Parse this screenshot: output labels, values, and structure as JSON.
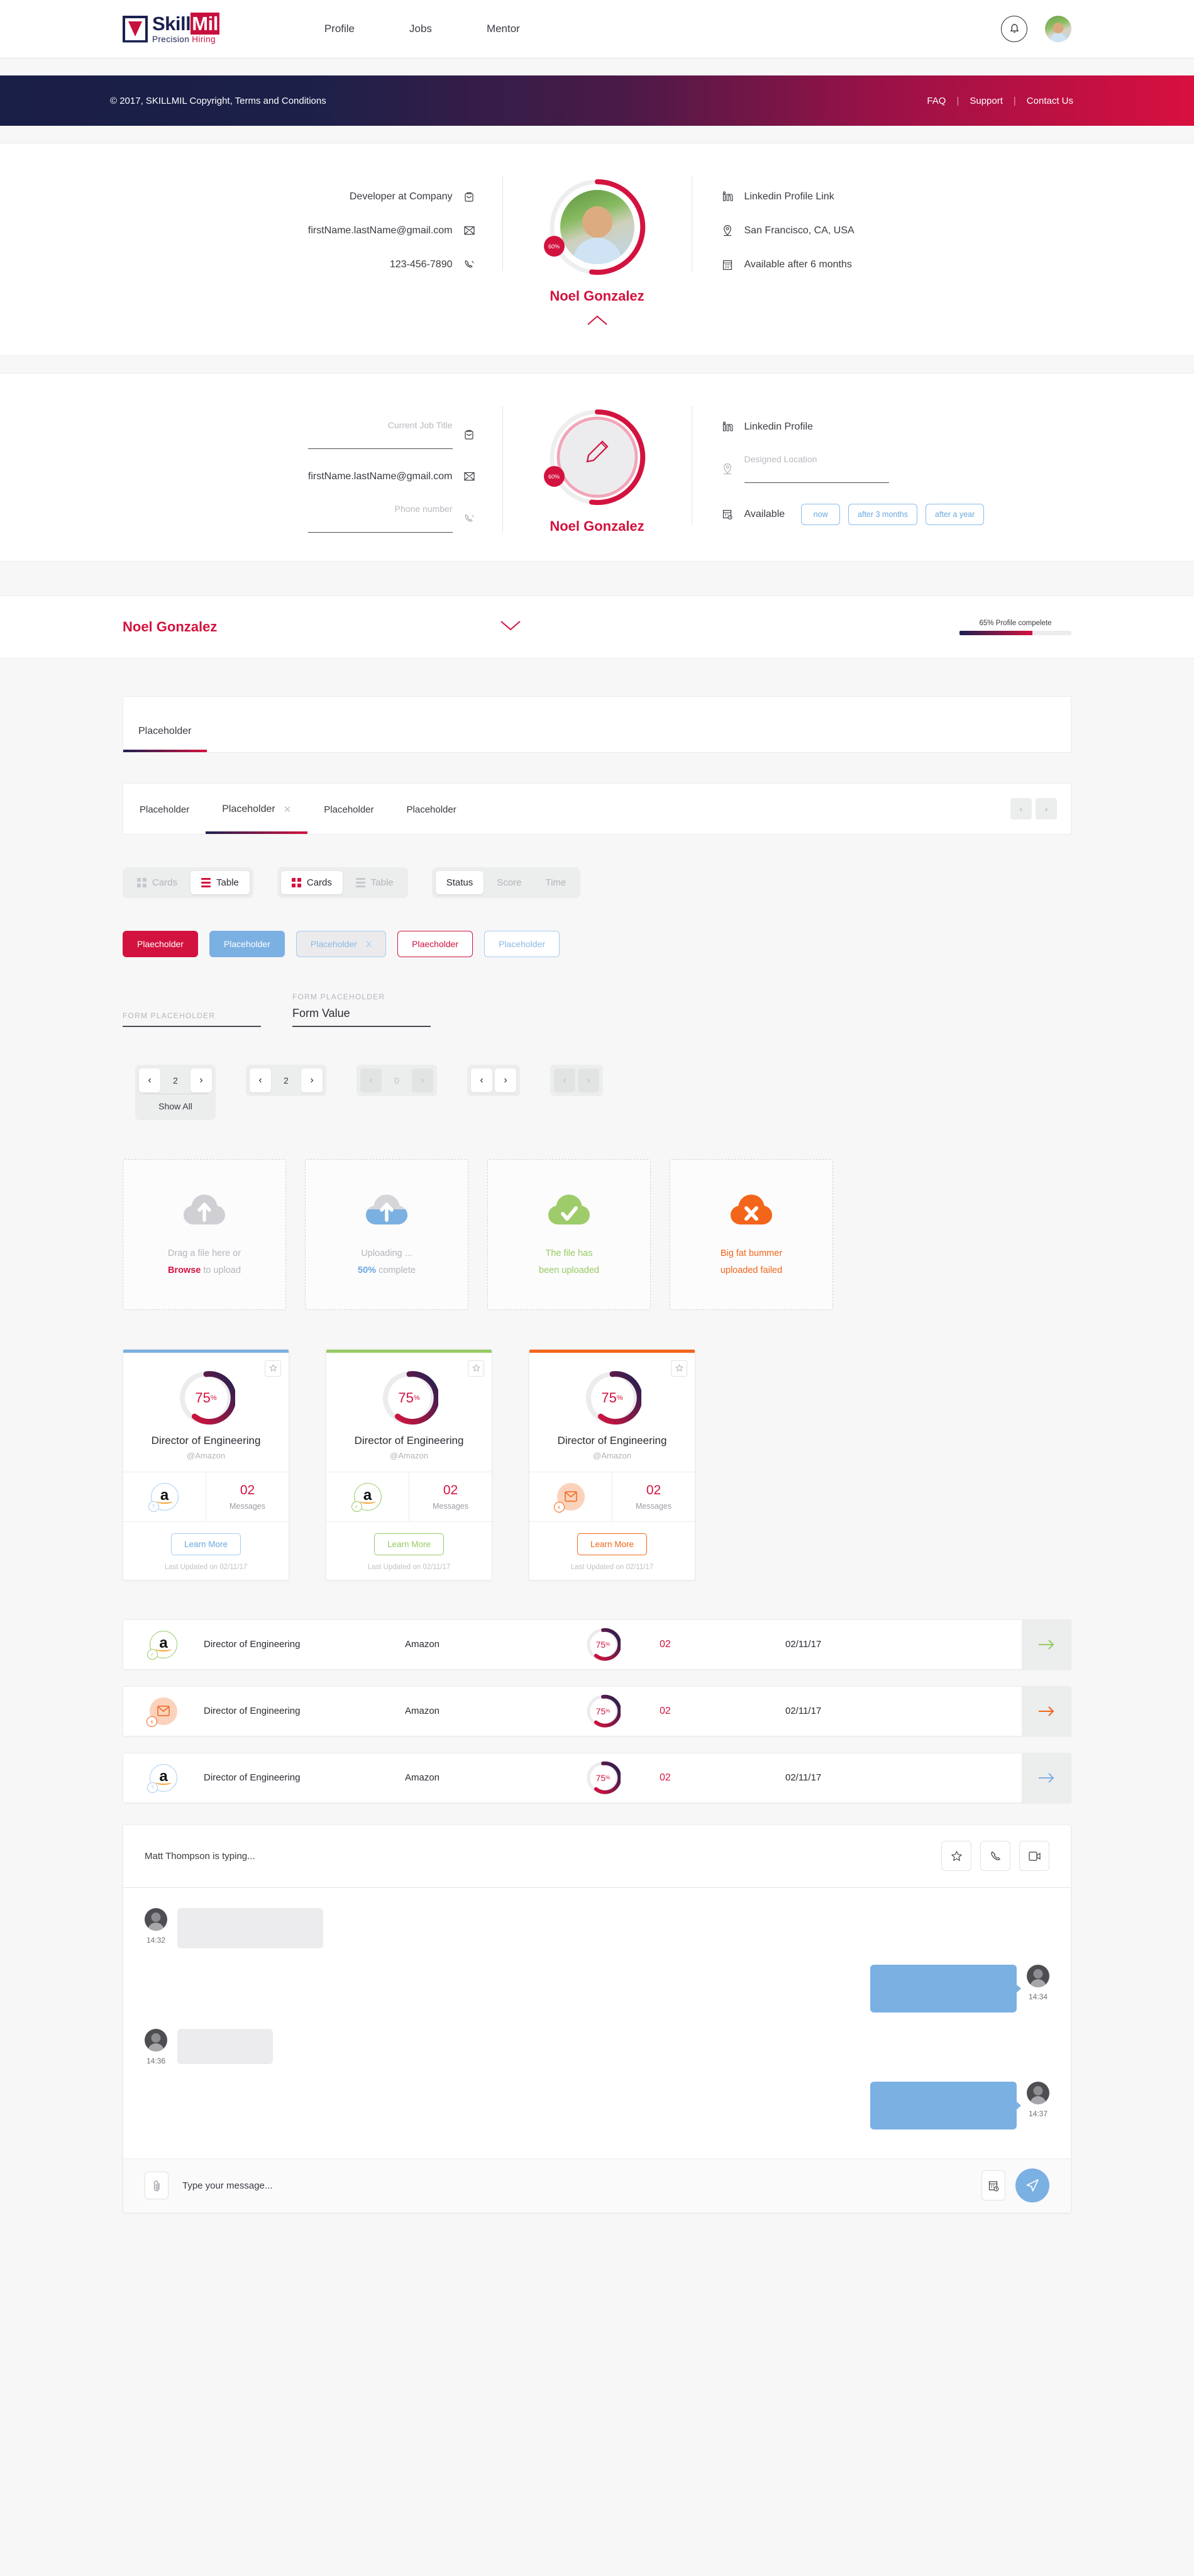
{
  "header": {
    "logo": {
      "name_part1": "Skill",
      "name_part2": "Mil",
      "tagline_1": "Precision",
      "tagline_2": "Hiring"
    },
    "nav": [
      {
        "label": "Profile"
      },
      {
        "label": "Jobs"
      },
      {
        "label": "Mentor"
      }
    ],
    "bell_icon": "bell-icon",
    "avatar_icon": "user-avatar"
  },
  "footbar": {
    "copyright": "© 2017, SKILLMIL   Copyright, Terms and Conditions",
    "links": [
      "FAQ",
      "Support",
      "Contact Us"
    ]
  },
  "profile_view": {
    "left": [
      {
        "text": "Developer at Company",
        "icon": "briefcase-icon"
      },
      {
        "text": "firstName.lastName@gmail.com",
        "icon": "envelope-icon"
      },
      {
        "text": "123-456-7890",
        "icon": "phone-icon"
      }
    ],
    "name": "Noel Gonzalez",
    "badge": "60%",
    "right": [
      {
        "text": "Linkedin Profile Link",
        "icon": "linkedin-icon"
      },
      {
        "text": "San Francisco, CA, USA",
        "icon": "location-pin-icon"
      },
      {
        "text": "Available after 6 months",
        "icon": "calendar-icon"
      }
    ]
  },
  "profile_edit": {
    "job_title_placeholder": "Current Job Title",
    "job_title_value": "",
    "email_value": "firstName.lastName@gmail.com",
    "phone_placeholder": "Phone number",
    "phone_value": "",
    "name": "Noel Gonzalez",
    "badge": "60%",
    "linkedin_label": "Linkedin Profile",
    "location_placeholder": "Designed Location",
    "location_value": "",
    "available_label": "Available",
    "available_options": [
      "now",
      "after 3 months",
      "after a year"
    ]
  },
  "namebar": {
    "name": "Noel Gonzalez",
    "progress_label": "65% Profile compelete",
    "progress_percent": 65
  },
  "tabs_single": [
    {
      "label": "Placeholder",
      "active": true
    }
  ],
  "tabs_multi": [
    {
      "label": "Placeholder",
      "active": false,
      "closable": false
    },
    {
      "label": "Placeholder",
      "active": true,
      "closable": true
    },
    {
      "label": "Placeholder",
      "active": false,
      "closable": false
    },
    {
      "label": "Placeholder",
      "active": false,
      "closable": false
    }
  ],
  "tabs_nav": {
    "prev": "‹",
    "next": "›"
  },
  "segment_groups": [
    {
      "items": [
        {
          "label": "Cards",
          "icon": "cards-grid-icon",
          "active": false
        },
        {
          "label": "Table",
          "icon": "table-rows-icon",
          "active": true
        }
      ]
    },
    {
      "items": [
        {
          "label": "Cards",
          "icon": "cards-grid-icon",
          "active": true
        },
        {
          "label": "Table",
          "icon": "table-rows-icon",
          "active": false
        }
      ]
    },
    {
      "items": [
        {
          "label": "Status",
          "icon": "",
          "active": true
        },
        {
          "label": "Score",
          "icon": "",
          "active": false
        },
        {
          "label": "Time",
          "icon": "",
          "active": false
        }
      ]
    }
  ],
  "pills": [
    {
      "label": "Plaecholder",
      "style": "solid-red"
    },
    {
      "label": "Placeholder",
      "style": "solid-blue"
    },
    {
      "label": "Placeholder",
      "style": "grey-blue",
      "close": "X"
    },
    {
      "label": "Plaecholder",
      "style": "out-red"
    },
    {
      "label": "Placeholder",
      "style": "out-blue"
    }
  ],
  "form_fields": [
    {
      "label": "FORM PLACEHOLDER",
      "value": ""
    },
    {
      "label": "FORM PLACEHOLDER",
      "value": "Form Value"
    }
  ],
  "pagers": [
    {
      "prev": "‹",
      "page": "2",
      "next": "›",
      "show_all": "Show All",
      "disabled": false,
      "arrows_only": false
    },
    {
      "prev": "‹",
      "page": "2",
      "next": "›",
      "disabled": false,
      "arrows_only": false
    },
    {
      "prev": "‹",
      "page": "0",
      "next": "›",
      "disabled": true,
      "arrows_only": false
    },
    {
      "prev": "‹",
      "next": "›",
      "disabled": false,
      "arrows_only": true
    },
    {
      "prev": "‹",
      "next": "›",
      "disabled": true,
      "arrows_only": true
    }
  ],
  "uploads": [
    {
      "state": "idle",
      "icon": "cloud-upload-icon",
      "line1": "Drag a file here or",
      "line2_strong": "Browse",
      "line2_rest": " to upload",
      "color": "#d3133f"
    },
    {
      "state": "uploading",
      "icon": "cloud-upload-icon",
      "line1": "Uploading ...",
      "line2_strong": "50%",
      "line2_rest": " complete",
      "color": "#6aa8e0"
    },
    {
      "state": "success",
      "icon": "cloud-check-icon",
      "line1": "The file has",
      "line2_strong": "",
      "line2_rest": "been uploaded",
      "color": "#97ca63"
    },
    {
      "state": "error",
      "icon": "cloud-error-icon",
      "line1": "Big fat bummer",
      "line2_strong": "",
      "line2_rest": "uploaded failed",
      "color": "#f2651a"
    }
  ],
  "job_cards": [
    {
      "accent": "#7bb0e2",
      "percent": "75",
      "percent_unit": "%",
      "title": "Director of Engineering",
      "company": "@Amazon",
      "logo": "amazon-logo",
      "badge": "?",
      "messages_count": "02",
      "messages_label": "Messages",
      "cta": "Learn More",
      "updated": "Last Updated on 02/11/17",
      "fav_icon": "star-icon"
    },
    {
      "accent": "#97ca63",
      "percent": "75",
      "percent_unit": "%",
      "title": "Director of Engineering",
      "company": "@Amazon",
      "logo": "amazon-logo",
      "badge": "✓",
      "messages_count": "02",
      "messages_label": "Messages",
      "cta": "Learn More",
      "updated": "Last Updated on 02/11/17",
      "fav_icon": "star-icon"
    },
    {
      "accent": "#f2651a",
      "percent": "75",
      "percent_unit": "%",
      "title": "Director of Engineering",
      "company": "@Amazon",
      "logo": "mail-badge",
      "badge": "x",
      "messages_count": "02",
      "messages_label": "Messages",
      "cta": "Learn More",
      "updated": "Last Updated on 02/11/17",
      "fav_icon": "star-icon"
    }
  ],
  "table_rows": [
    {
      "logo": "amazon-logo",
      "accent": "#97ca63",
      "badge": "✓",
      "title": "Director of Engineering",
      "company": "Amazon",
      "percent": "75",
      "percent_unit": "%",
      "messages": "02",
      "date": "02/11/17",
      "arrow": "→"
    },
    {
      "logo": "mail-badge",
      "accent": "#f2651a",
      "badge": "x",
      "title": "Director of Engineering",
      "company": "Amazon",
      "percent": "75",
      "percent_unit": "%",
      "messages": "02",
      "date": "02/11/17",
      "arrow": "→"
    },
    {
      "logo": "amazon-logo",
      "accent": "#7bb0e2",
      "badge": "?",
      "title": "Director of Engineering",
      "company": "Amazon",
      "percent": "75",
      "percent_unit": "%",
      "messages": "02",
      "date": "02/11/17",
      "arrow": "→"
    }
  ],
  "chat": {
    "typing_status": "Matt Thompson is typing...",
    "actions": [
      "star-icon",
      "phone-icon",
      "video-call-icon"
    ],
    "messages": [
      {
        "side": "them",
        "time": "14:32",
        "size": "long"
      },
      {
        "side": "me",
        "time": "14:34",
        "size": "long"
      },
      {
        "side": "them",
        "time": "14:36",
        "size": "short"
      },
      {
        "side": "me",
        "time": "14:37",
        "size": "long"
      }
    ],
    "input_placeholder": "Type your message...",
    "input_value": "",
    "attach_icon": "paperclip-icon",
    "calendar_icon": "calendar-clock-icon",
    "send_icon": "send-plane-icon"
  },
  "colors": {
    "brand_red": "#d3133f",
    "brand_navy": "#1b2050",
    "blue": "#7bb0e2",
    "green": "#97ca63",
    "orange": "#f2651a"
  }
}
